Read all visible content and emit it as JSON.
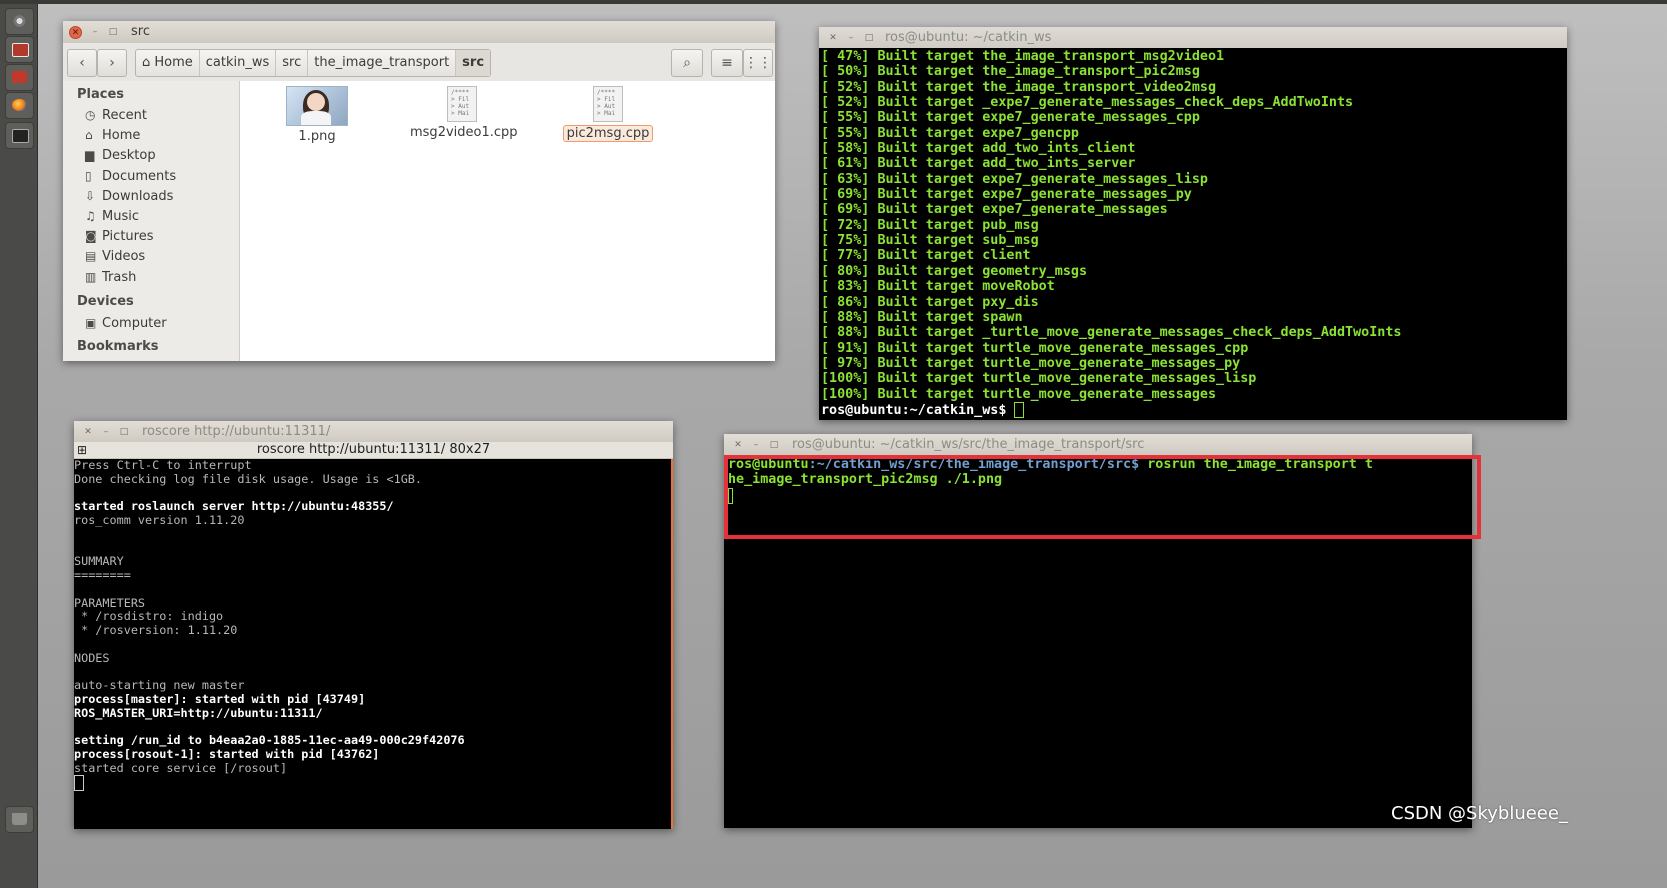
{
  "launcher": {
    "items": [
      "dash-icon",
      "files-icon",
      "software-icon",
      "firefox-icon",
      "terminal-icon"
    ],
    "trash": "trash-icon"
  },
  "file_manager": {
    "title": "src",
    "path": [
      "Home",
      "catkin_ws",
      "src",
      "the_image_transport",
      "src"
    ],
    "sidebar": {
      "places_header": "Places",
      "places": [
        {
          "icon": "clock-icon",
          "glyph": "◷",
          "label": "Recent"
        },
        {
          "icon": "home-icon",
          "glyph": "⌂",
          "label": "Home"
        },
        {
          "icon": "folder-icon",
          "glyph": "▆",
          "label": "Desktop"
        },
        {
          "icon": "document-icon",
          "glyph": "▯",
          "label": "Documents"
        },
        {
          "icon": "download-icon",
          "glyph": "⇩",
          "label": "Downloads"
        },
        {
          "icon": "music-icon",
          "glyph": "♫",
          "label": "Music"
        },
        {
          "icon": "camera-icon",
          "glyph": "◙",
          "label": "Pictures"
        },
        {
          "icon": "film-icon",
          "glyph": "▤",
          "label": "Videos"
        },
        {
          "icon": "trash-icon",
          "glyph": "▥",
          "label": "Trash"
        }
      ],
      "devices_header": "Devices",
      "devices": [
        {
          "icon": "drive-icon",
          "glyph": "▣",
          "label": "Computer"
        }
      ],
      "bookmarks_header": "Bookmarks"
    },
    "files": [
      {
        "name": "1.png",
        "type": "image"
      },
      {
        "name": "msg2video1.cpp",
        "type": "text",
        "preview": "/****\n> Fil\n> Aut\n> Mai"
      },
      {
        "name": "pic2msg.cpp",
        "type": "text",
        "selected": true,
        "preview": "/****\n> Fil\n> Aut\n> Mai"
      }
    ]
  },
  "terminal_build": {
    "title": "ros@ubuntu: ~/catkin_ws",
    "lines": [
      {
        "pct": "[ 47%]",
        "text": "Built target the_image_transport_msg2video1"
      },
      {
        "pct": "[ 50%]",
        "text": "Built target the_image_transport_pic2msg"
      },
      {
        "pct": "[ 52%]",
        "text": "Built target the_image_transport_video2msg"
      },
      {
        "pct": "[ 52%]",
        "text": "Built target _expe7_generate_messages_check_deps_AddTwoInts"
      },
      {
        "pct": "[ 55%]",
        "text": "Built target expe7_generate_messages_cpp"
      },
      {
        "pct": "[ 55%]",
        "text": "Built target expe7_gencpp"
      },
      {
        "pct": "[ 58%]",
        "text": "Built target add_two_ints_client"
      },
      {
        "pct": "[ 61%]",
        "text": "Built target add_two_ints_server"
      },
      {
        "pct": "[ 63%]",
        "text": "Built target expe7_generate_messages_lisp"
      },
      {
        "pct": "[ 69%]",
        "text": "Built target expe7_generate_messages_py"
      },
      {
        "pct": "[ 69%]",
        "text": "Built target expe7_generate_messages"
      },
      {
        "pct": "[ 72%]",
        "text": "Built target pub_msg"
      },
      {
        "pct": "[ 75%]",
        "text": "Built target sub_msg"
      },
      {
        "pct": "[ 77%]",
        "text": "Built target client"
      },
      {
        "pct": "[ 80%]",
        "text": "Built target geometry_msgs"
      },
      {
        "pct": "[ 83%]",
        "text": "Built target moveRobot"
      },
      {
        "pct": "[ 86%]",
        "text": "Built target pxy_dis"
      },
      {
        "pct": "[ 88%]",
        "text": "Built target spawn"
      },
      {
        "pct": "[ 88%]",
        "text": "Built target _turtle_move_generate_messages_check_deps_AddTwoInts"
      },
      {
        "pct": "[ 91%]",
        "text": "Built target turtle_move_generate_messages_cpp"
      },
      {
        "pct": "[ 97%]",
        "text": "Built target turtle_move_generate_messages_py"
      },
      {
        "pct": "[100%]",
        "text": "Built target turtle_move_generate_messages_lisp"
      },
      {
        "pct": "[100%]",
        "text": "Built target turtle_move_generate_messages"
      }
    ],
    "prompt": "ros@ubuntu:~/catkin_ws$ "
  },
  "terminal_roscore": {
    "title": "roscore http://ubuntu:11311/",
    "subtitle": "roscore http://ubuntu:11311/ 80x27",
    "lines": [
      {
        "style": "gr",
        "text": "Press Ctrl-C to interrupt"
      },
      {
        "style": "gr",
        "text": "Done checking log file disk usage. Usage is <1GB."
      },
      {
        "style": "gr",
        "text": ""
      },
      {
        "style": "wh",
        "text": "started roslaunch server http://ubuntu:48355/"
      },
      {
        "style": "gr",
        "text": "ros_comm version 1.11.20"
      },
      {
        "style": "gr",
        "text": ""
      },
      {
        "style": "gr",
        "text": ""
      },
      {
        "style": "gr",
        "text": "SUMMARY"
      },
      {
        "style": "gr",
        "text": "========"
      },
      {
        "style": "gr",
        "text": ""
      },
      {
        "style": "gr",
        "text": "PARAMETERS"
      },
      {
        "style": "gr",
        "text": " * /rosdistro: indigo"
      },
      {
        "style": "gr",
        "text": " * /rosversion: 1.11.20"
      },
      {
        "style": "gr",
        "text": ""
      },
      {
        "style": "gr",
        "text": "NODES"
      },
      {
        "style": "gr",
        "text": ""
      },
      {
        "style": "gr",
        "text": "auto-starting new master"
      },
      {
        "style": "wh",
        "text": "process[master]: started with pid [43749]"
      },
      {
        "style": "wh",
        "text": "ROS_MASTER_URI=http://ubuntu:11311/"
      },
      {
        "style": "gr",
        "text": ""
      },
      {
        "style": "wh",
        "text": "setting /run_id to b4eaa2a0-1885-11ec-aa49-000c29f42076"
      },
      {
        "style": "wh",
        "text": "process[rosout-1]: started with pid [43762]"
      },
      {
        "style": "gr",
        "text": "started core service [/rosout]"
      }
    ]
  },
  "terminal_run": {
    "title": "ros@ubuntu: ~/catkin_ws/src/the_image_transport/src",
    "prompt_user": "ros@ubuntu",
    "prompt_path": ":~/catkin_ws/src/the_image_transport/src$",
    "command_line1": " rosrun the_image_transport t",
    "command_line2": "he_image_transport_pic2msg ./1.png",
    "highlight_color": "#e5323a"
  },
  "watermark": "CSDN @Skybluee​e_"
}
